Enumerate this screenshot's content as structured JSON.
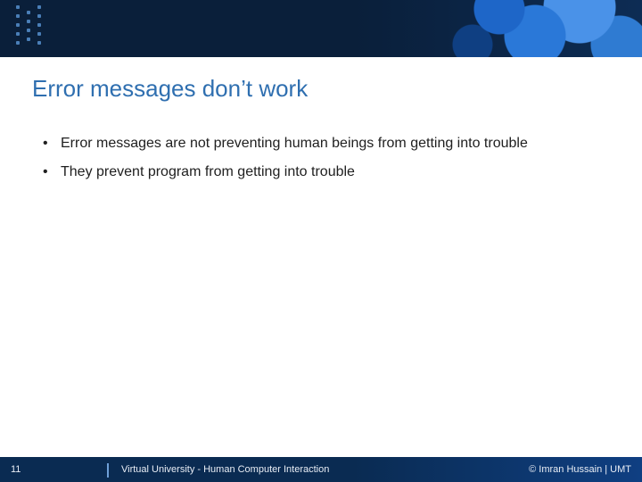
{
  "title": "Error messages don’t work",
  "bullets": [
    "Error messages are not preventing human beings from getting into trouble",
    "They prevent program from getting into trouble"
  ],
  "footer": {
    "page_number": "11",
    "course": "Virtual University - Human Computer Interaction",
    "copyright": "© Imran Hussain | UMT"
  }
}
